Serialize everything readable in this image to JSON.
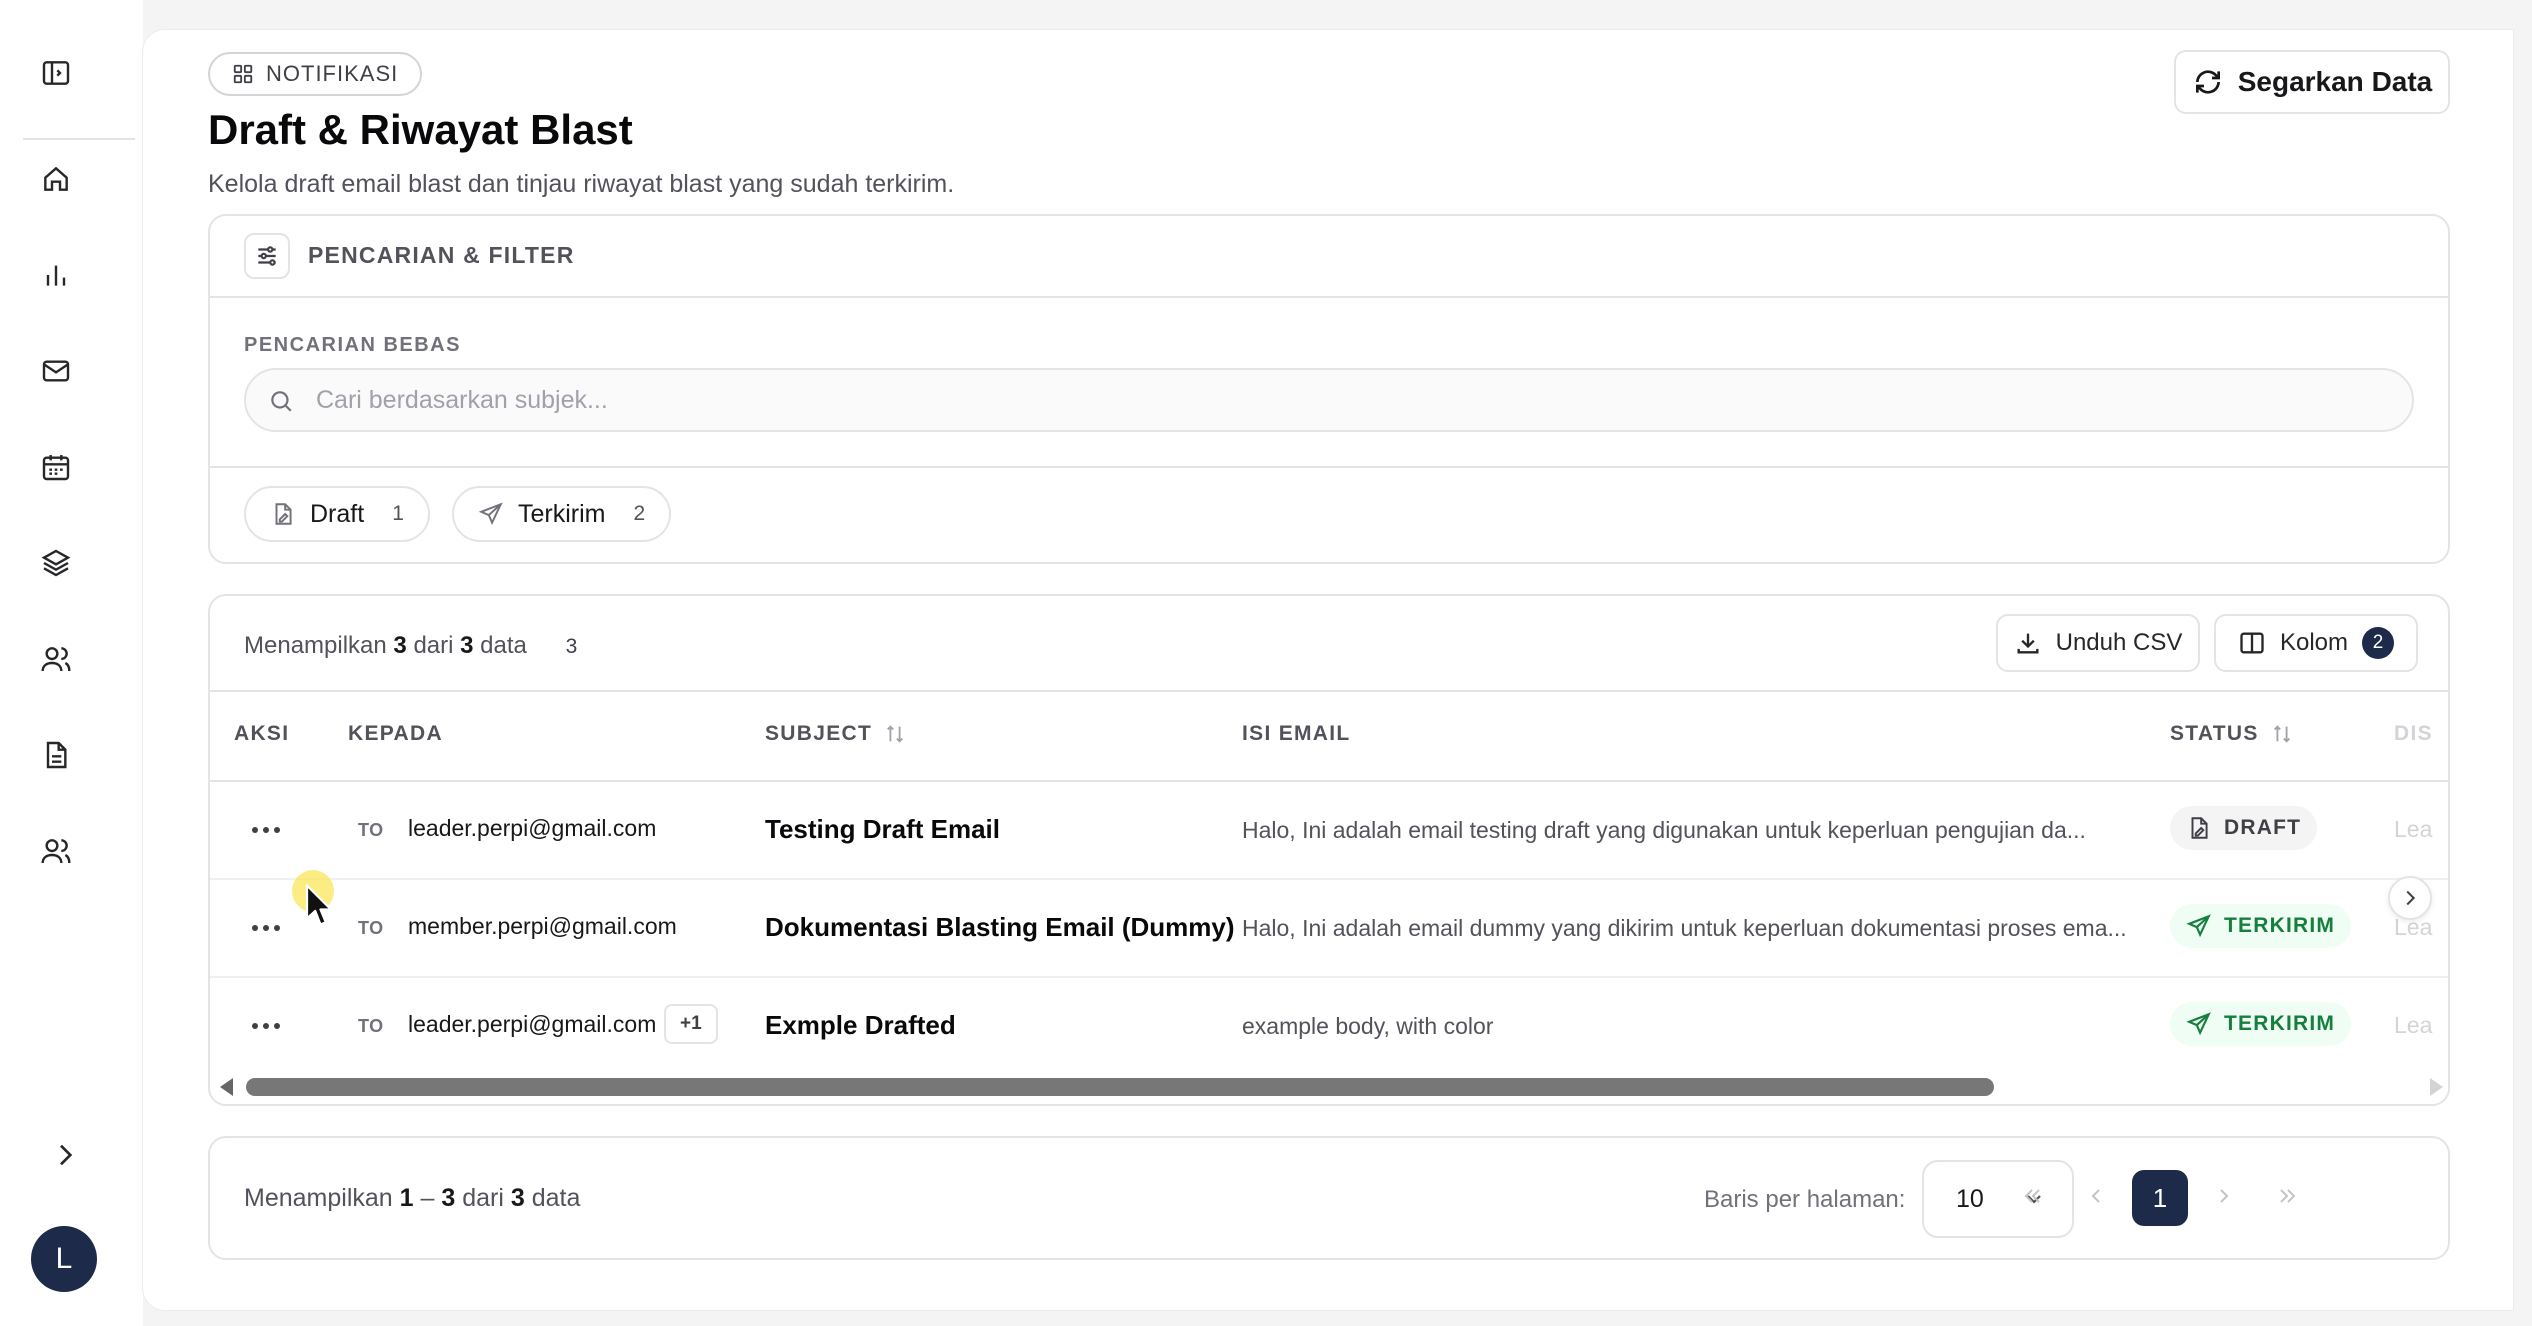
{
  "header": {
    "badge": "NOTIFIKASI",
    "title": "Draft & Riwayat Blast",
    "subtitle": "Kelola draft email blast dan tinjau riwayat blast yang sudah terkirim.",
    "refresh_label": "Segarkan Data"
  },
  "sidebar": {
    "items": [
      {
        "icon": "home-icon"
      },
      {
        "icon": "bar-chart-icon"
      },
      {
        "icon": "mail-icon"
      },
      {
        "icon": "calendar-icon"
      },
      {
        "icon": "layers-icon"
      },
      {
        "icon": "users-icon"
      },
      {
        "icon": "file-text-icon"
      },
      {
        "icon": "users-icon"
      }
    ],
    "avatar_letter": "L"
  },
  "filter": {
    "title": "PENCARIAN & FILTER",
    "search_label": "PENCARIAN BEBAS",
    "search_placeholder": "Cari berdasarkan subjek...",
    "search_value": "",
    "chips": [
      {
        "label": "Draft",
        "count": "1"
      },
      {
        "label": "Terkirim",
        "count": "2"
      }
    ]
  },
  "table": {
    "summary": {
      "prefix": "Menampilkan",
      "shown": "3",
      "mid": "dari",
      "total": "3",
      "suffix": "data",
      "extra": "3"
    },
    "download_label": "Unduh CSV",
    "columns_label": "Kolom",
    "columns_count": "2",
    "headers": {
      "aksi": "AKSI",
      "kepada": "KEPADA",
      "subject": "SUBJECT",
      "isi": "ISI EMAIL",
      "status": "STATUS",
      "dis": "DIS"
    },
    "rows": [
      {
        "to_tag": "TO",
        "to": "leader.perpi@gmail.com",
        "extra": "",
        "subject": "Testing Draft Email",
        "body": "Halo, Ini adalah email testing draft yang digunakan untuk keperluan pengujian da...",
        "status": "DRAFT",
        "dis": "Lea"
      },
      {
        "to_tag": "TO",
        "to": "member.perpi@gmail.com",
        "extra": "",
        "subject": "Dokumentasi Blasting Email (Dummy)",
        "body": "Halo, Ini adalah email dummy yang dikirim untuk keperluan dokumentasi proses ema...",
        "status": "TERKIRIM",
        "dis": "Lea"
      },
      {
        "to_tag": "TO",
        "to": "leader.perpi@gmail.com",
        "extra": "+1",
        "subject": "Exmple Drafted",
        "body": "example body, with color",
        "status": "TERKIRIM",
        "dis": "Lea"
      }
    ]
  },
  "pagination": {
    "summary": {
      "prefix": "Menampilkan",
      "from": "1",
      "dash": "–",
      "to": "3",
      "mid": "dari",
      "total": "3",
      "suffix": "data"
    },
    "rows_label": "Baris per halaman:",
    "rows_value": "10",
    "current_page": "1"
  },
  "colors": {
    "accent": "#1e2a4a",
    "sent": "#15803d"
  }
}
